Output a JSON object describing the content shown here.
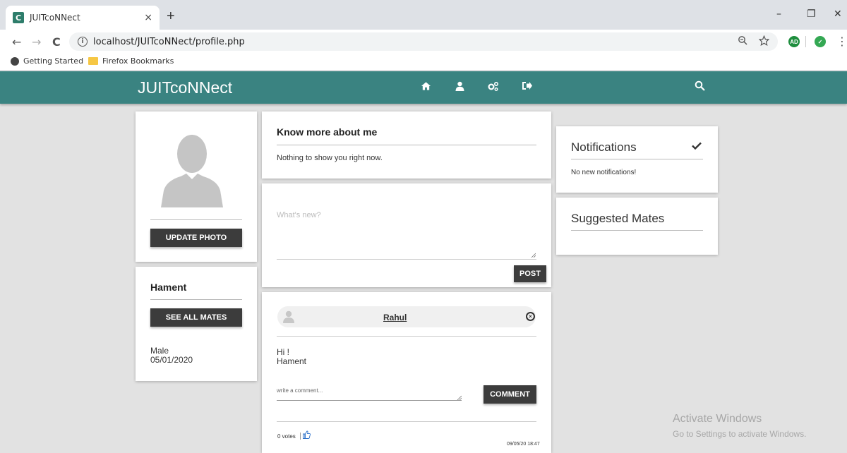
{
  "browser": {
    "tab_title": "JUITcoNNect",
    "tab_favicon": "C",
    "tab_close": "×",
    "new_tab": "+",
    "url": "localhost/JUITcoNNect/profile.php",
    "window_controls": {
      "minimize": "–",
      "restore": "❐",
      "close": "✕"
    },
    "nav": {
      "back": "←",
      "forward": "→",
      "reload": "C"
    },
    "extension_label": "AD",
    "bookmarks": [
      "Getting Started",
      "Firefox Bookmarks"
    ]
  },
  "app": {
    "brand": "JUITcoNNect",
    "nav_icons": [
      "home-icon",
      "user-icon",
      "cogs-icon",
      "sign-out-icon",
      "search-icon"
    ],
    "accent_color": "#3a8381"
  },
  "profile": {
    "update_photo_label": "UPDATE PHOTO",
    "name": "Hament",
    "see_all_mates_label": "SEE ALL MATES",
    "gender": "Male",
    "dob": "05/01/2020"
  },
  "about": {
    "title": "Know more about me",
    "body": "Nothing to show you right now."
  },
  "composer": {
    "placeholder": "What's new?",
    "post_label": "POST"
  },
  "post": {
    "author": "Rahul",
    "content_line1": "Hi !",
    "content_line2": "Hament",
    "comment_placeholder": "write a comment...",
    "comment_label": "COMMENT",
    "votes": "0 votes",
    "timestamp": "09/05/20 18:47"
  },
  "notifications": {
    "title": "Notifications",
    "body": "No new notifications!"
  },
  "suggested": {
    "title": "Suggested Mates"
  },
  "watermark": {
    "line1": "Activate Windows",
    "line2": "Go to Settings to activate Windows."
  }
}
